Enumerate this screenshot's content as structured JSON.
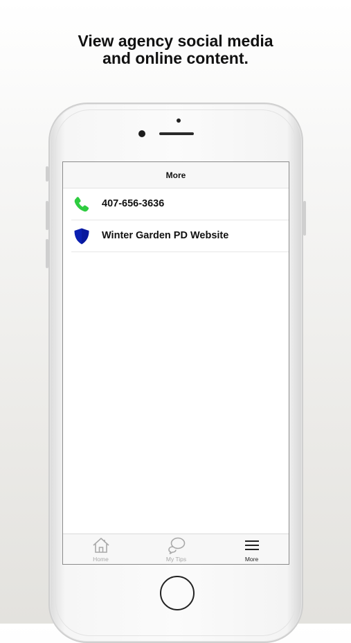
{
  "headline": {
    "line1": "View agency social media",
    "line2": "and online content."
  },
  "nav": {
    "title": "More"
  },
  "list": {
    "items": [
      {
        "label": "407-656-3636",
        "icon": "phone-icon",
        "icon_color": "#2ecc40"
      },
      {
        "label": "Winter Garden PD Website",
        "icon": "shield-icon",
        "icon_color": "#0a1fb0"
      }
    ]
  },
  "tabs": [
    {
      "label": "Home",
      "icon": "home-icon",
      "active": false
    },
    {
      "label": "My Tips",
      "icon": "chat-bubbles-icon",
      "active": false
    },
    {
      "label": "More",
      "icon": "menu-icon",
      "active": true
    }
  ],
  "colors": {
    "tab_inactive": "#a9a9a9",
    "tab_active": "#222222"
  }
}
